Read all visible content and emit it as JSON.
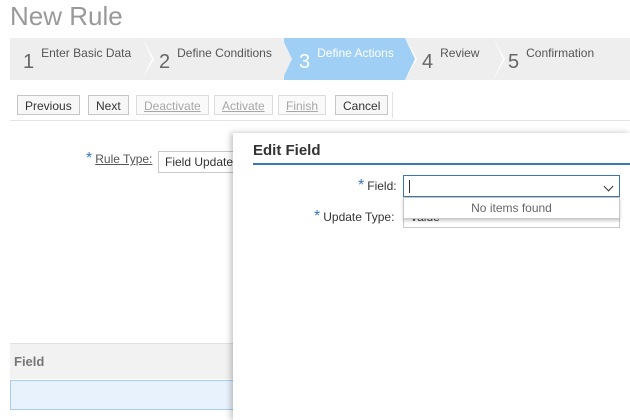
{
  "page": {
    "title": "New Rule"
  },
  "wizard": {
    "steps": [
      {
        "num": "1",
        "label": "Enter Basic Data"
      },
      {
        "num": "2",
        "label": "Define Conditions"
      },
      {
        "num": "3",
        "label": "Define Actions"
      },
      {
        "num": "4",
        "label": "Review"
      },
      {
        "num": "5",
        "label": "Confirmation"
      }
    ],
    "active_step": "3"
  },
  "toolbar": {
    "previous": "Previous",
    "next": "Next",
    "deactivate": "Deactivate",
    "activate": "Activate",
    "finish": "Finish",
    "cancel": "Cancel"
  },
  "form": {
    "rule_type_label": "Rule Type:",
    "rule_type_value": "Field Update"
  },
  "table": {
    "column_header": "Field"
  },
  "dialog": {
    "title": "Edit Field",
    "field_label": "Field:",
    "field_value": "",
    "dropdown_message": "No items found",
    "update_type_label": "Update Type:",
    "update_type_value": "Value"
  },
  "colors": {
    "accent": "#3a78b5",
    "active_step": "#9fcff5",
    "required_marker": "#3a78b5"
  }
}
